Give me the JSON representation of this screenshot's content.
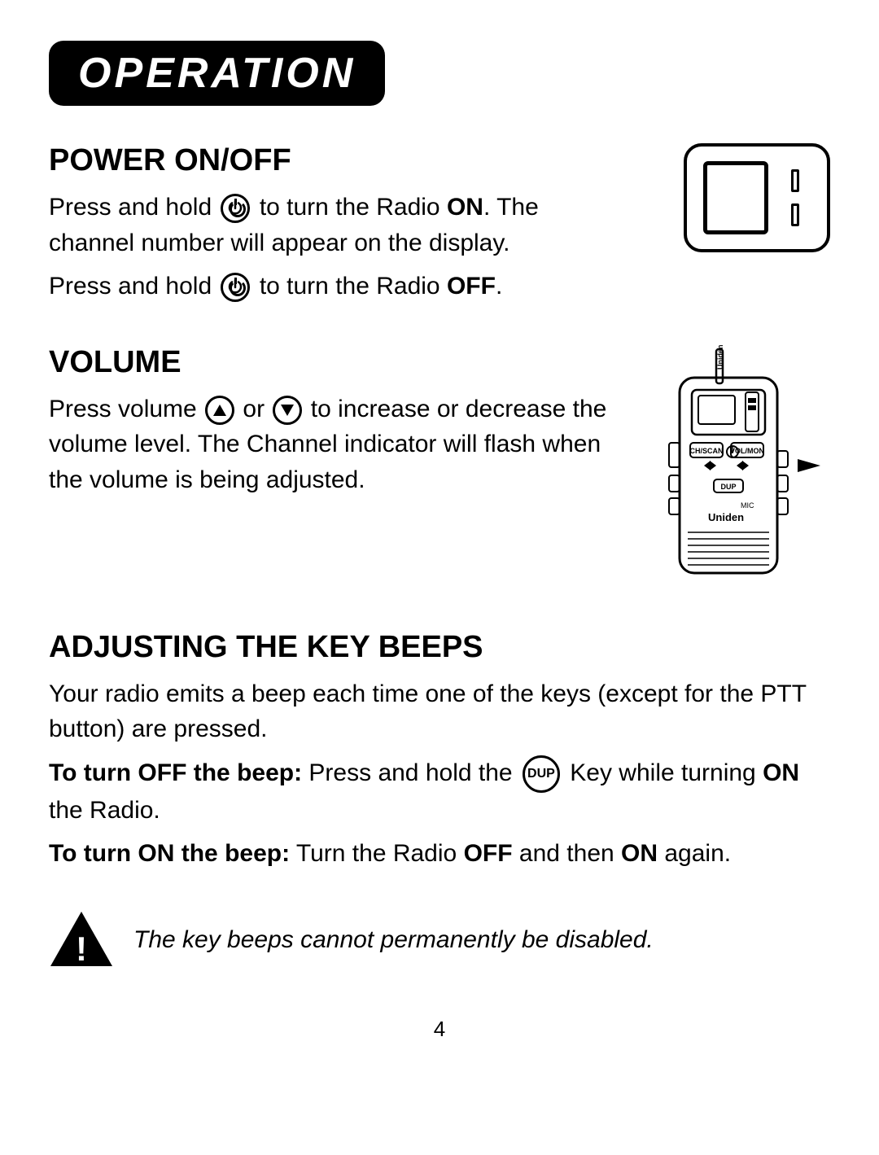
{
  "header": {
    "title": "OPERATION"
  },
  "power_section": {
    "title": "POWER ON/OFF",
    "paragraph1_before": "Press and hold ",
    "paragraph1_icon": "power-button",
    "paragraph1_after": " to turn the Radio ",
    "paragraph1_bold": "ON",
    "paragraph1_end": ". The channel number will appear on the display.",
    "paragraph2_before": "Press and hold ",
    "paragraph2_icon": "power-button",
    "paragraph2_after": " to turn the Radio ",
    "paragraph2_bold": "OFF",
    "paragraph2_end": "."
  },
  "volume_section": {
    "title": "VOLUME",
    "text_before": "Press volume ",
    "icon_up": "▲",
    "or": "or",
    "icon_down": "▼",
    "text_after": " to increase or decrease the volume level. The Channel indicator will flash when the volume is being adjusted."
  },
  "beeps_section": {
    "title": "ADJUSTING THE KEY BEEPS",
    "intro": "Your radio emits a beep each time one of the keys (except for the PTT button) are pressed.",
    "turn_off_label": "To turn OFF the beep:",
    "turn_off_text": " Press and hold the ",
    "turn_off_key": "DUP",
    "turn_off_end": " Key while turning ",
    "turn_off_bold": "ON",
    "turn_off_final": " the Radio.",
    "turn_on_label": "To turn ON the beep:",
    "turn_on_text": " Turn the Radio ",
    "turn_on_off_bold": "OFF",
    "turn_on_text2": " and then ",
    "turn_on_bold": "ON",
    "turn_on_end": " again."
  },
  "warning": {
    "text": "The key beeps cannot permanently be disabled."
  },
  "page_number": "4"
}
